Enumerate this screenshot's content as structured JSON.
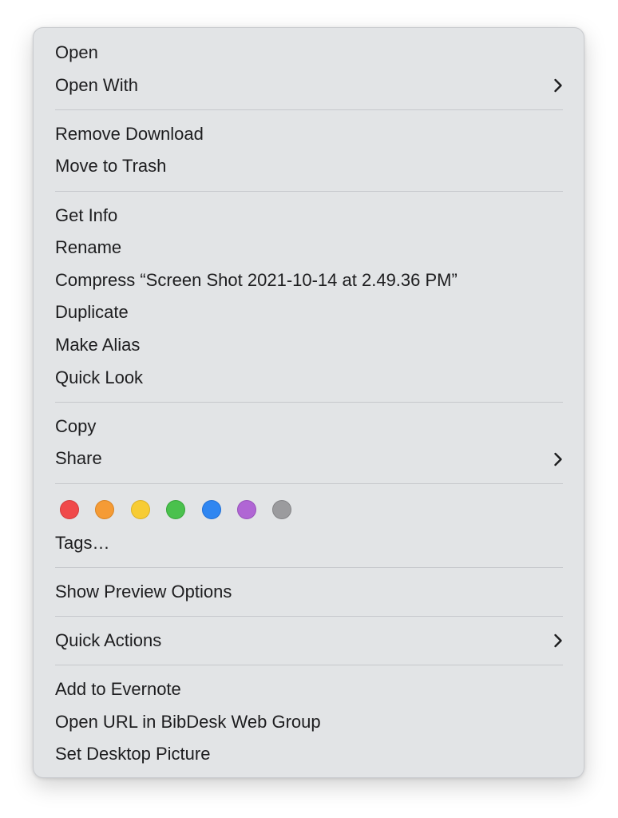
{
  "menu": {
    "groups": [
      {
        "items": [
          {
            "label": "Open"
          },
          {
            "label": "Open With",
            "submenu": true
          }
        ]
      },
      {
        "items": [
          {
            "label": "Remove Download"
          },
          {
            "label": "Move to Trash"
          }
        ]
      },
      {
        "items": [
          {
            "label": "Get Info"
          },
          {
            "label": "Rename"
          },
          {
            "label": "Compress “Screen Shot 2021-10-14 at 2.49.36 PM”"
          },
          {
            "label": "Duplicate"
          },
          {
            "label": "Make Alias"
          },
          {
            "label": "Quick Look"
          }
        ]
      },
      {
        "items": [
          {
            "label": "Copy"
          },
          {
            "label": "Share",
            "submenu": true
          }
        ]
      },
      {
        "tags": {
          "colors": [
            {
              "name": "red",
              "color": "#f0494a",
              "border": "#d33b3c"
            },
            {
              "name": "orange",
              "color": "#f59b35",
              "border": "#d98424"
            },
            {
              "name": "yellow",
              "color": "#f7cc34",
              "border": "#dcb225"
            },
            {
              "name": "green",
              "color": "#4ac14d",
              "border": "#37a63a"
            },
            {
              "name": "blue",
              "color": "#2f86f1",
              "border": "#2170d6"
            },
            {
              "name": "purple",
              "color": "#b066d4",
              "border": "#9853bb"
            },
            {
              "name": "gray",
              "color": "#9b9b9e",
              "border": "#848487"
            }
          ],
          "label": "Tags…"
        }
      },
      {
        "items": [
          {
            "label": "Show Preview Options"
          }
        ]
      },
      {
        "items": [
          {
            "label": "Quick Actions",
            "submenu": true
          }
        ]
      },
      {
        "items": [
          {
            "label": "Add to Evernote"
          },
          {
            "label": "Open URL in BibDesk Web Group"
          },
          {
            "label": "Set Desktop Picture"
          }
        ]
      }
    ]
  },
  "icons": {
    "submenu": "chevron-right-icon"
  }
}
